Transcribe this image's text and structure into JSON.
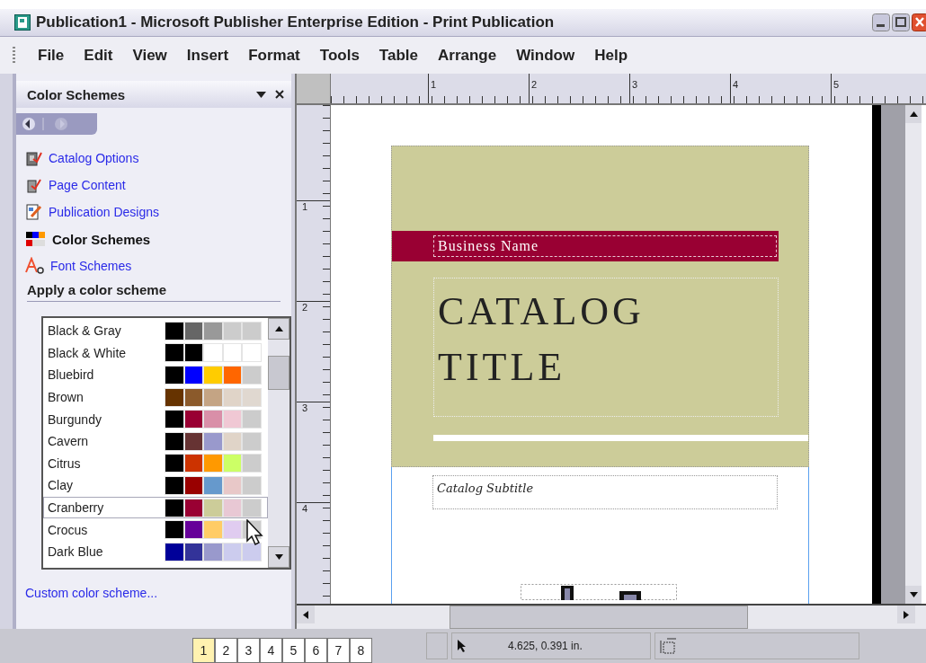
{
  "window": {
    "title": "Publication1 - Microsoft Publisher Enterprise Edition - Print Publication"
  },
  "menu": [
    "File",
    "Edit",
    "View",
    "Insert",
    "Format",
    "Tools",
    "Table",
    "Arrange",
    "Window",
    "Help"
  ],
  "task_pane": {
    "title": "Color Schemes",
    "links": [
      {
        "label": "Catalog Options",
        "kind": "catalog",
        "selected": false
      },
      {
        "label": "Page Content",
        "kind": "page",
        "selected": false
      },
      {
        "label": "Publication Designs",
        "kind": "designs",
        "selected": false
      },
      {
        "label": "Color Schemes",
        "kind": "colors",
        "selected": true
      },
      {
        "label": "Font Schemes",
        "kind": "fonts",
        "selected": false
      }
    ],
    "section_heading": "Apply a color scheme",
    "schemes": [
      {
        "name": "Black & Gray",
        "swatches": [
          {
            "color": "#000000"
          },
          {
            "color": "#666666"
          },
          {
            "color": "#999999"
          },
          {
            "color": "#cccccc"
          },
          {
            "color": "#cccccc"
          }
        ],
        "selected": false
      },
      {
        "name": "Black & White",
        "swatches": [
          {
            "color": "#000000"
          },
          {
            "color": "#000000"
          },
          {
            "color": "#ffffff"
          },
          {
            "color": "#ffffff"
          },
          {
            "color": "#ffffff"
          }
        ],
        "selected": false
      },
      {
        "name": "Bluebird",
        "swatches": [
          {
            "color": "#000000"
          },
          {
            "color": "#0000ff"
          },
          {
            "color": "#ffcc00"
          },
          {
            "color": "#ff6600"
          },
          {
            "color": "#cccccc"
          }
        ],
        "selected": false
      },
      {
        "name": "Brown",
        "swatches": [
          {
            "color": "#663300"
          },
          {
            "color": "#8b5a2b"
          },
          {
            "color": "#c4a484"
          },
          {
            "color": "#e0d4c8"
          },
          {
            "color": "#e0d8d0"
          }
        ],
        "selected": false
      },
      {
        "name": "Burgundy",
        "swatches": [
          {
            "color": "#000000"
          },
          {
            "color": "#990033"
          },
          {
            "color": "#d98fa8"
          },
          {
            "color": "#f0c8d4"
          },
          {
            "color": "#cccccc"
          }
        ],
        "selected": false
      },
      {
        "name": "Cavern",
        "swatches": [
          {
            "color": "#000000"
          },
          {
            "color": "#663333"
          },
          {
            "color": "#9999cc"
          },
          {
            "color": "#e0d4c8"
          },
          {
            "color": "#cccccc"
          }
        ],
        "selected": false
      },
      {
        "name": "Citrus",
        "swatches": [
          {
            "color": "#000000"
          },
          {
            "color": "#cc3300"
          },
          {
            "color": "#ff9900"
          },
          {
            "color": "#ccff66"
          },
          {
            "color": "#cccccc"
          }
        ],
        "selected": false
      },
      {
        "name": "Clay",
        "swatches": [
          {
            "color": "#000000"
          },
          {
            "color": "#990000"
          },
          {
            "color": "#6699cc"
          },
          {
            "color": "#e8c8c8"
          },
          {
            "color": "#cccccc"
          }
        ],
        "selected": false
      },
      {
        "name": "Cranberry",
        "swatches": [
          {
            "color": "#000000"
          },
          {
            "color": "#990033"
          },
          {
            "color": "#cccc99"
          },
          {
            "color": "#e8c8d4"
          },
          {
            "color": "#cccccc"
          }
        ],
        "selected": true
      },
      {
        "name": "Crocus",
        "swatches": [
          {
            "color": "#000000"
          },
          {
            "color": "#660099"
          },
          {
            "color": "#ffcc66"
          },
          {
            "color": "#e0ccf0"
          },
          {
            "color": "#cccccc"
          }
        ],
        "selected": false
      },
      {
        "name": "Dark Blue",
        "swatches": [
          {
            "color": "#000099"
          },
          {
            "color": "#333399"
          },
          {
            "color": "#9999cc"
          },
          {
            "color": "#ccccee"
          },
          {
            "color": "#ccccee"
          }
        ],
        "selected": false
      }
    ],
    "custom_link": "Custom color scheme..."
  },
  "rulers": {
    "horizontal": [
      "1",
      "2",
      "3",
      "4",
      "5"
    ],
    "vertical": [
      "1",
      "2",
      "3",
      "4"
    ]
  },
  "document": {
    "business_name": "Business Name",
    "title": "CATALOG TITLE",
    "subtitle": "Catalog Subtitle"
  },
  "page_tabs": [
    {
      "label": "1",
      "selected": true
    },
    {
      "label": "2",
      "selected": false
    },
    {
      "label": "3",
      "selected": false
    },
    {
      "label": "4",
      "selected": false
    },
    {
      "label": "5",
      "selected": false
    },
    {
      "label": "6",
      "selected": false
    },
    {
      "label": "7",
      "selected": false
    },
    {
      "label": "8",
      "selected": false
    }
  ],
  "status_bar": {
    "position": "4.625, 0.391 in."
  }
}
